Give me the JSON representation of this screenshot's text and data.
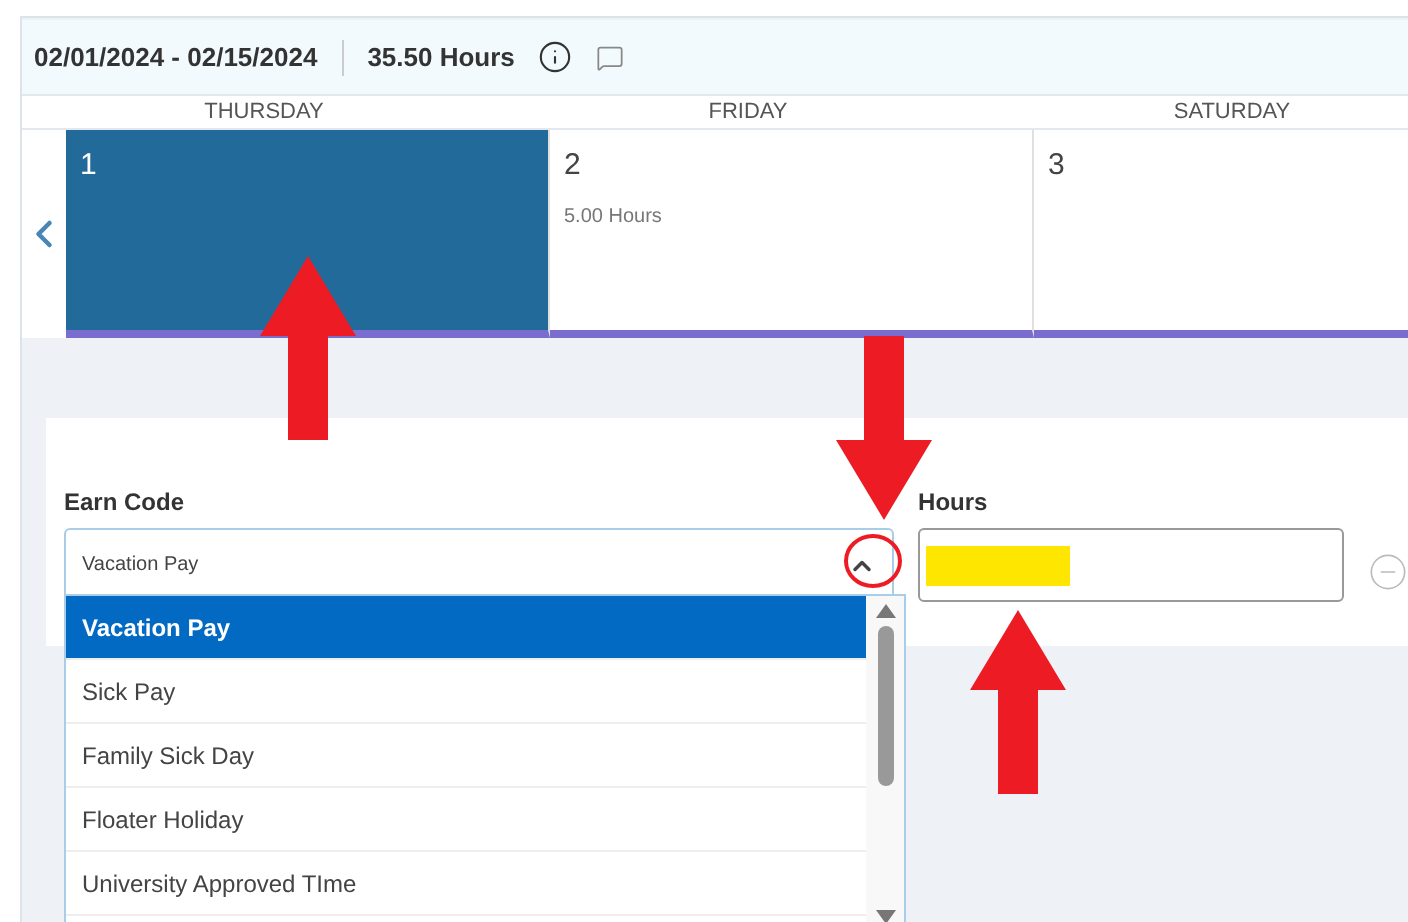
{
  "period": {
    "range": "02/01/2024 - 02/15/2024",
    "total": "35.50 Hours"
  },
  "days": [
    {
      "weekday": "THURSDAY",
      "date": "1",
      "selected": true
    },
    {
      "weekday": "FRIDAY",
      "date": "2",
      "hours": "5.00 Hours",
      "selected": false
    },
    {
      "weekday": "SATURDAY",
      "date": "3",
      "selected": false
    }
  ],
  "form": {
    "earn_code_label": "Earn Code",
    "earn_code_value": "Vacation Pay",
    "expanded": true,
    "hours_label": "Hours"
  },
  "options": [
    {
      "label": "Vacation Pay",
      "selected": true
    },
    {
      "label": "Sick Pay",
      "selected": false
    },
    {
      "label": "Family Sick Day",
      "selected": false
    },
    {
      "label": "Floater Holiday",
      "selected": false
    },
    {
      "label": "University Approved TIme",
      "selected": false
    }
  ]
}
